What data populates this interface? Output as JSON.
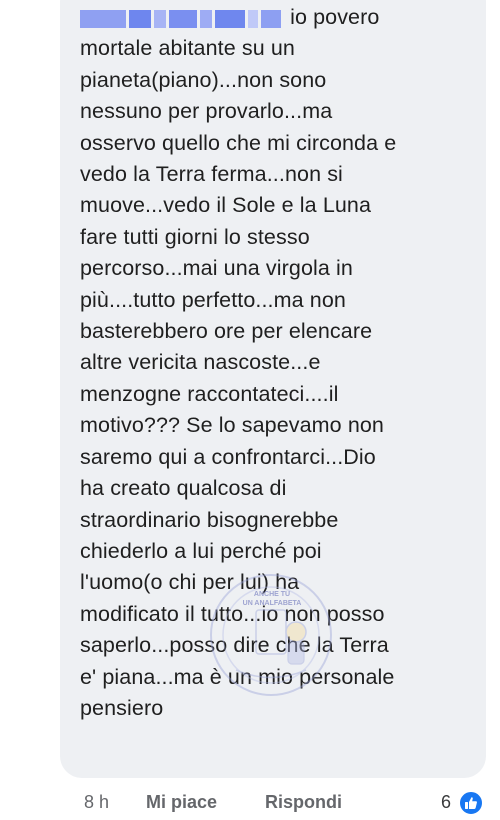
{
  "comment": {
    "author_hidden": true,
    "lines": [
      "io povero",
      "mortale abitante su un",
      "pianeta(piano)...non sono",
      "nessuno per provarlo...ma",
      "osservo quello che mi circonda e",
      "vedo la Terra ferma...non si",
      "muove...vedo il Sole e la Luna",
      "fare tutti giorni lo stesso",
      "percorso...mai una virgola in",
      "più....tutto perfetto...ma non",
      "basterebbero ore per elencare",
      "altre vericita nascoste...e",
      "menzogne raccontateci....il",
      "motivo??? Se lo sapevamo non",
      "saremo qui a confrontarci...Dio",
      "ha creato qualcosa di",
      "straordinario bisognerebbe",
      "chiederlo a lui perché poi",
      "l'uomo(o chi per lui) ha",
      "modificato il tutto...io non posso",
      "saperlo...posso dire che la Terra",
      "e' piana...ma è un mio personale",
      "pensiero"
    ]
  },
  "watermark": {
    "line1": "ANCHE TU",
    "line2": "UN ANALFABETA"
  },
  "actions": {
    "time": "8 h",
    "like_label": "Mi piace",
    "reply_label": "Rispondi",
    "reaction_count": "6"
  },
  "colors": {
    "bubble": "#eef0f3",
    "text": "#1f1f1f",
    "meta": "#65676b",
    "like_blue": "#1877f2",
    "name_mask_blue": "#7a8ff0"
  },
  "icons": {
    "reaction": "like-thumb-icon"
  }
}
